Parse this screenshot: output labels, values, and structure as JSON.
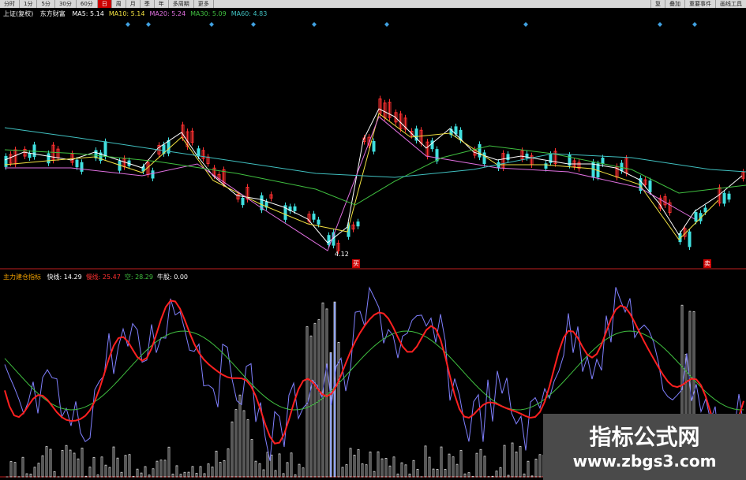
{
  "toolbar": {
    "tabs": [
      "分时",
      "1分",
      "5分",
      "30分",
      "60分",
      "日",
      "周",
      "月",
      "季",
      "年",
      "多周期",
      "更多"
    ],
    "active_tab": "日",
    "right_tabs": [
      "复",
      "叠加",
      "重要事件",
      "画线工具"
    ]
  },
  "main_legend": {
    "stock": "上证(复权)",
    "indicator": "东方财富",
    "items": [
      {
        "label": "MA5: 5.14",
        "color": "#ffffff"
      },
      {
        "label": "MA10: 5.14",
        "color": "#f0e040"
      },
      {
        "label": "MA20: 5.24",
        "color": "#e070e0"
      },
      {
        "label": "MA30: 5.09",
        "color": "#40c040"
      },
      {
        "label": "MA60: 4.83",
        "color": "#40c0c0"
      }
    ]
  },
  "price_low_label": "4.12",
  "markers": {
    "buy": "买",
    "sell": "卖"
  },
  "indicator_legend": {
    "name": "主力建仓指标",
    "items": [
      {
        "label": "快线: 14.29",
        "color": "#ffffff"
      },
      {
        "label": "慢线: 25.47",
        "color": "#ff3030"
      },
      {
        "label": "空: 28.29",
        "color": "#40c040"
      },
      {
        "label": "牛股: 0.00",
        "color": "#ffffff"
      }
    ]
  },
  "watermark": {
    "title": "指标公式网",
    "url": "www.zbgs3.com"
  },
  "colors": {
    "up": "#ff3030",
    "down": "#40e0e0",
    "ma5": "#ffffff",
    "ma10": "#f0e040",
    "ma20": "#e070e0",
    "ma30": "#40c040",
    "ma60": "#40c0c0",
    "ind_slow": "#ff2020",
    "ind_fast": "#8080ff",
    "ind_signal": "#40c040"
  }
}
